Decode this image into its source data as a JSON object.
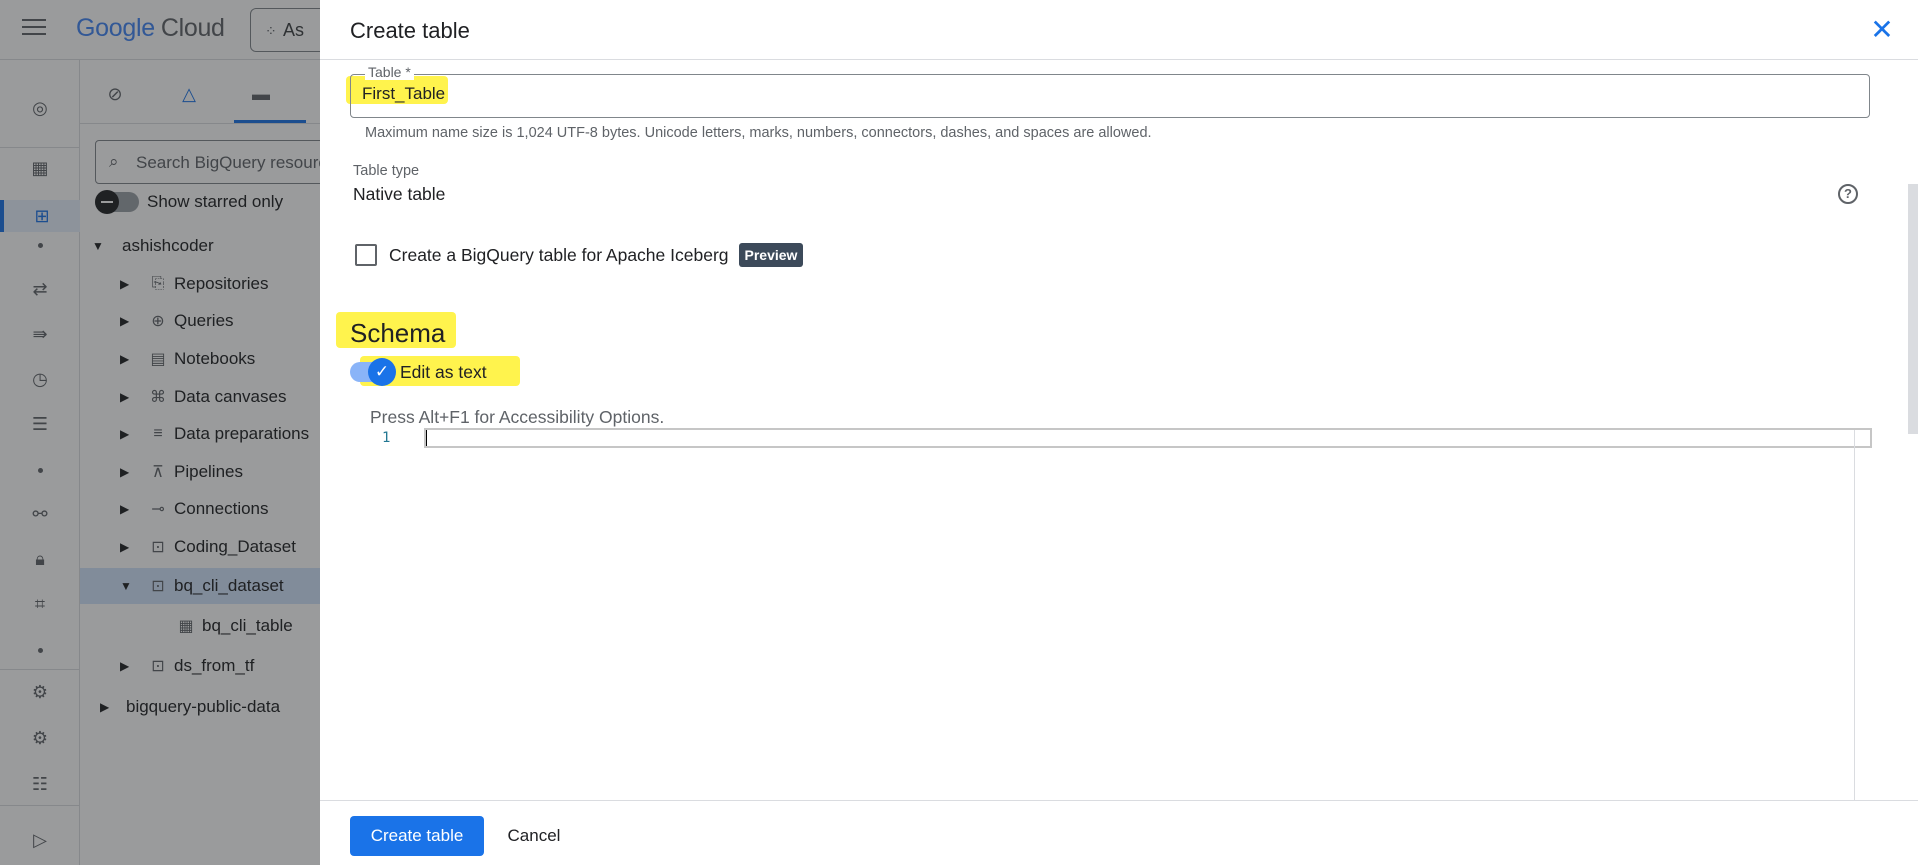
{
  "app": {
    "logo_google": "Google",
    "logo_cloud": "Cloud",
    "project_chip": "As"
  },
  "explorer": {
    "search_placeholder": "Search BigQuery resources",
    "show_starred_label": "Show starred only",
    "project": "ashishcoder",
    "items": [
      {
        "label": "Repositories"
      },
      {
        "label": "Queries"
      },
      {
        "label": "Notebooks"
      },
      {
        "label": "Data canvases"
      },
      {
        "label": "Data preparations"
      },
      {
        "label": "Pipelines"
      },
      {
        "label": "Connections"
      },
      {
        "label": "Coding_Dataset"
      },
      {
        "label": "bq_cli_dataset"
      },
      {
        "label": "bq_cli_table"
      },
      {
        "label": "ds_from_tf"
      }
    ],
    "public_data": "bigquery-public-data"
  },
  "dialog": {
    "title": "Create table",
    "table_field": {
      "label": "Table *",
      "value": "First_Table",
      "hint": "Maximum name size is 1,024 UTF-8 bytes. Unicode letters, marks, numbers, connectors, dashes, and spaces are allowed."
    },
    "table_type": {
      "label": "Table type",
      "value": "Native table"
    },
    "iceberg": {
      "label": "Create a BigQuery table for Apache Iceberg",
      "badge": "Preview",
      "checked": false
    },
    "schema": {
      "title": "Schema",
      "edit_as_text_label": "Edit as text",
      "edit_as_text_on": true,
      "editor_hint": "Press Alt+F1 for Accessibility Options.",
      "line_number": "1"
    },
    "footer": {
      "create_label": "Create table",
      "cancel_label": "Cancel"
    }
  },
  "colors": {
    "accent": "#1a73e8",
    "highlight": "#fff34d"
  }
}
